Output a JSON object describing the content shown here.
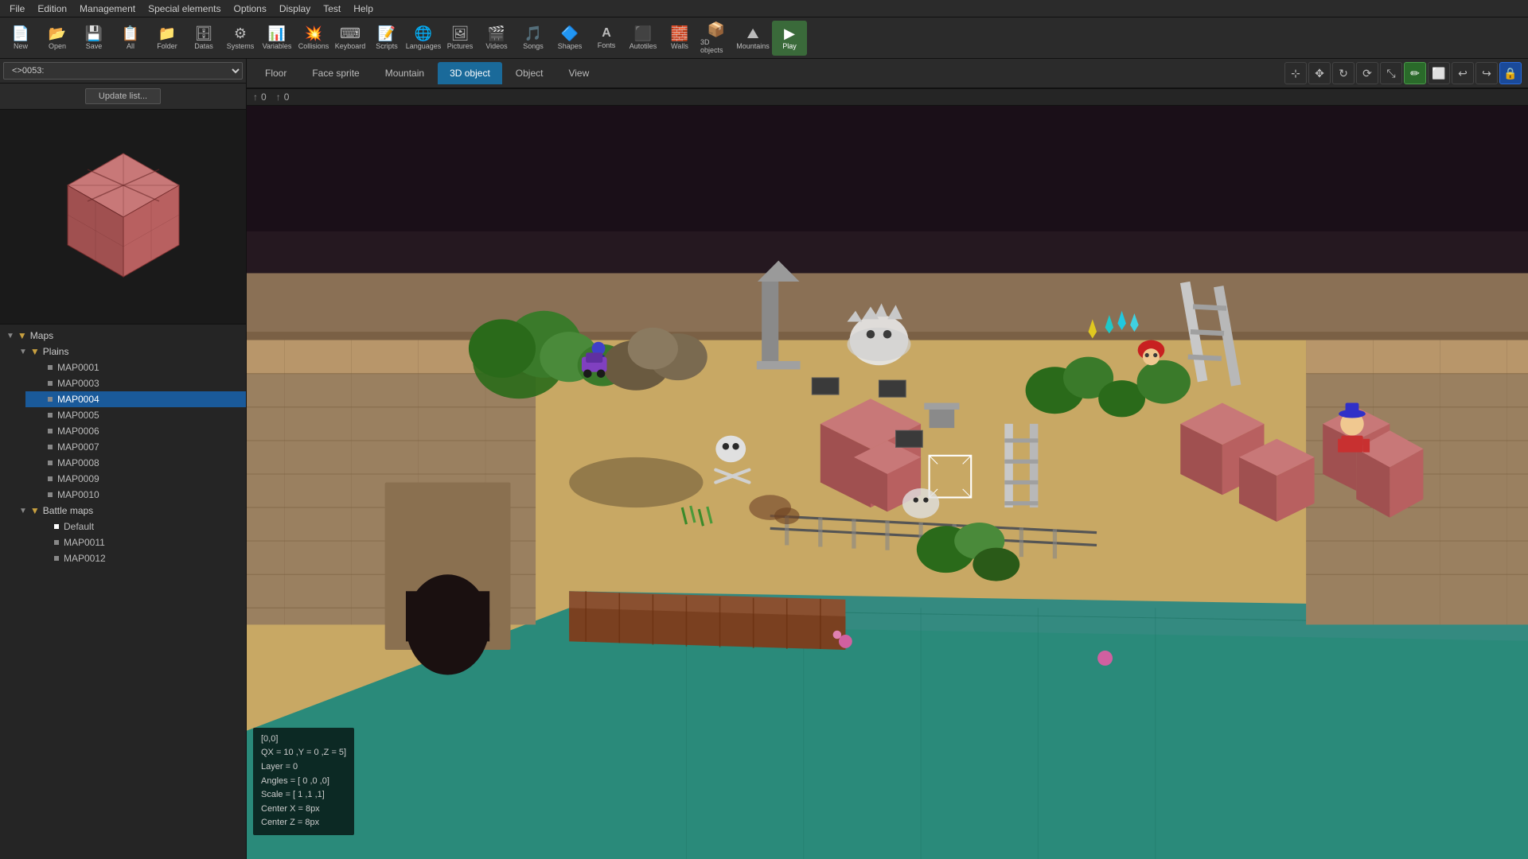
{
  "menubar": {
    "items": [
      "File",
      "Edition",
      "Management",
      "Special elements",
      "Options",
      "Display",
      "Test",
      "Help"
    ]
  },
  "toolbar": {
    "buttons": [
      {
        "id": "new",
        "label": "New",
        "icon": "📄"
      },
      {
        "id": "open",
        "label": "Open",
        "icon": "📂"
      },
      {
        "id": "save",
        "label": "Save",
        "icon": "💾"
      },
      {
        "id": "all",
        "label": "All",
        "icon": "📋"
      },
      {
        "id": "folder",
        "label": "Folder",
        "icon": "📁"
      },
      {
        "id": "datas",
        "label": "Datas",
        "icon": "🗄"
      },
      {
        "id": "systems",
        "label": "Systems",
        "icon": "⚙"
      },
      {
        "id": "variables",
        "label": "Variables",
        "icon": "📊"
      },
      {
        "id": "collisions",
        "label": "Collisions",
        "icon": "💥"
      },
      {
        "id": "keyboard",
        "label": "Keyboard",
        "icon": "⌨"
      },
      {
        "id": "scripts",
        "label": "Scripts",
        "icon": "📝"
      },
      {
        "id": "languages",
        "label": "Languages",
        "icon": "🌐"
      },
      {
        "id": "pictures",
        "label": "Pictures",
        "icon": "🖼"
      },
      {
        "id": "videos",
        "label": "Videos",
        "icon": "🎬"
      },
      {
        "id": "songs",
        "label": "Songs",
        "icon": "🎵"
      },
      {
        "id": "shapes",
        "label": "Shapes",
        "icon": "🔷"
      },
      {
        "id": "fonts",
        "label": "Fonts",
        "icon": "A"
      },
      {
        "id": "autotiles",
        "label": "Autotiles",
        "icon": "⬛"
      },
      {
        "id": "walls",
        "label": "Walls",
        "icon": "🧱"
      },
      {
        "id": "3dobjects",
        "label": "3D objects",
        "icon": "📦"
      },
      {
        "id": "mountains",
        "label": "Mountains",
        "icon": "⛰"
      },
      {
        "id": "play",
        "label": "Play",
        "icon": "▶"
      }
    ]
  },
  "left_panel": {
    "map_selector": {
      "value": "<>0053:",
      "placeholder": "<>0053:"
    },
    "update_list_label": "Update list...",
    "tree": {
      "maps_label": "Maps",
      "plains_label": "Plains",
      "maps": [
        "MAP0001",
        "MAP0003",
        "MAP0004",
        "MAP0005",
        "MAP0006",
        "MAP0007",
        "MAP0008",
        "MAP0009",
        "MAP0010"
      ],
      "selected_map": "MAP0004",
      "battle_maps_label": "Battle maps",
      "default_label": "Default",
      "battle_maps": [
        "MAP0011",
        "MAP0012"
      ]
    }
  },
  "tabs": {
    "items": [
      "Floor",
      "Face sprite",
      "Mountain",
      "3D object",
      "Object",
      "View"
    ],
    "active": "3D object"
  },
  "coords": {
    "x": "0",
    "y": "0"
  },
  "right_toolbar": {
    "buttons": [
      {
        "id": "select",
        "icon": "⊹",
        "active": false
      },
      {
        "id": "move",
        "icon": "✥",
        "active": false
      },
      {
        "id": "rotate",
        "icon": "↻",
        "active": false
      },
      {
        "id": "scale",
        "icon": "⤡",
        "active": false
      },
      {
        "id": "pin",
        "icon": "📌",
        "active": false
      },
      {
        "id": "draw",
        "icon": "✏",
        "active": true
      },
      {
        "id": "erase",
        "icon": "⬜",
        "active": false
      },
      {
        "id": "undo",
        "icon": "↩",
        "active": false
      },
      {
        "id": "redo",
        "icon": "↪",
        "active": false
      },
      {
        "id": "lock",
        "icon": "🔒",
        "active": true
      }
    ]
  },
  "info_overlay": {
    "line1": "[0,0]",
    "line2": "QX = 10 ,Y = 0 ,Z = 5]",
    "line3": "Layer = 0",
    "line4": "Angles = [ 0 ,0 ,0]",
    "line5": "Scale = [ 1 ,1 ,1]",
    "line6": "Center X = 8px",
    "line7": "Center Z = 8px"
  }
}
